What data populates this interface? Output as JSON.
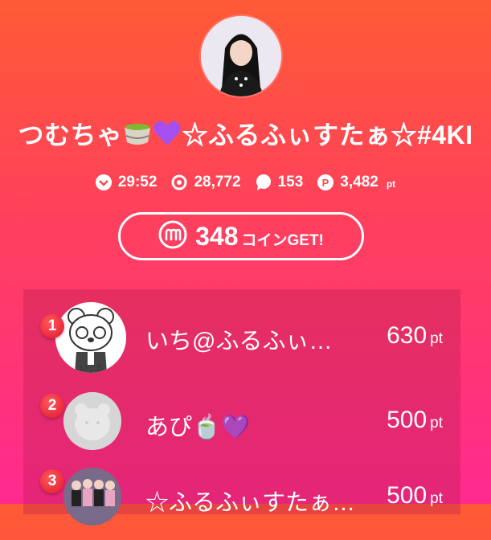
{
  "profile": {
    "title": "つむちゃ🍵💜☆ふるふぃすたぁ☆#4KI",
    "title_parts": [
      "つむちゃ",
      "☆ふるふぃすたぁ☆#4KI"
    ],
    "avatar_icon": "profile-photo"
  },
  "stats": {
    "time": "29:52",
    "viewers": "28,772",
    "comments": "153",
    "points": "3,482",
    "points_unit": "pt"
  },
  "coin": {
    "amount": "348",
    "suffix": "コインGET!"
  },
  "ranking": [
    {
      "rank": "1",
      "name": "いち@ふるふぃ…",
      "points": "630",
      "unit": "pt"
    },
    {
      "rank": "2",
      "name": "あぴ🍵💜",
      "points": "500",
      "unit": "pt"
    },
    {
      "rank": "3",
      "name": "☆ふるふぃすたぁ…",
      "points": "500",
      "unit": "pt"
    }
  ],
  "colors": {
    "gradient_top": "#ff5a36",
    "gradient_bottom": "#ff2a8f",
    "badge": "#e0152f",
    "heart": "#a64ff0",
    "tea": "#8fc23c"
  }
}
